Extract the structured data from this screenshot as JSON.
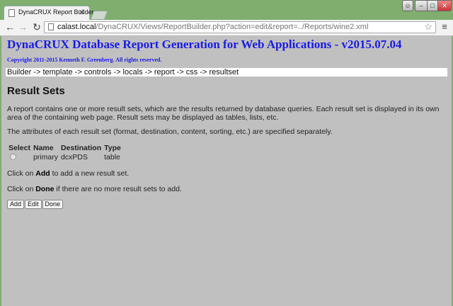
{
  "browser": {
    "tab_title": "DynaCRUX Report Builder",
    "tab_close": "✕",
    "url_host": "calast.local",
    "url_path": "/DynaCRUX/Views/ReportBuilder.php?action=edit&report=../Reports/wine2.xml",
    "back": "←",
    "forward": "→",
    "reload": "↻",
    "star": "☆",
    "menu": "≡",
    "window_controls": {
      "minimize": "–",
      "maximize": "□",
      "close": "✕",
      "user": "☺"
    }
  },
  "page": {
    "app_title": "DynaCRUX Database Report Generation for Web Applications - v2015.07.04",
    "copyright": "Copyright 2011-2015 Kenneth F. Greenberg. All rights reserved.",
    "breadcrumb": "Builder -> template -> controls -> locals -> report -> css -> resultset",
    "section_title": "Result Sets",
    "para1": "A report contains one or more result sets, which are the results returned by database queries. Each result set is displayed in its own area of the containing web page. Result sets may be displayed as tables, lists, etc.",
    "para2": "The attributes of each result set (format, destination, content, sorting, etc.) are specified separately.",
    "table": {
      "headers": [
        "Select",
        "Name",
        "Destination",
        "Type"
      ],
      "rows": [
        {
          "name": "primary",
          "destination": "dcxPDS",
          "type": "table"
        }
      ]
    },
    "hint_add": {
      "before": "Click on ",
      "bold": "Add",
      "after": " to add a new result set."
    },
    "hint_done": {
      "before": "Click on ",
      "bold": "Done",
      "after": " if there are no more result sets to add."
    },
    "buttons": {
      "add": "Add",
      "edit": "Edit",
      "done": "Done"
    }
  },
  "colors": {
    "frame": "#7fae6e",
    "page_bg": "#c0c0c0",
    "title_blue": "#1a1ae6"
  }
}
